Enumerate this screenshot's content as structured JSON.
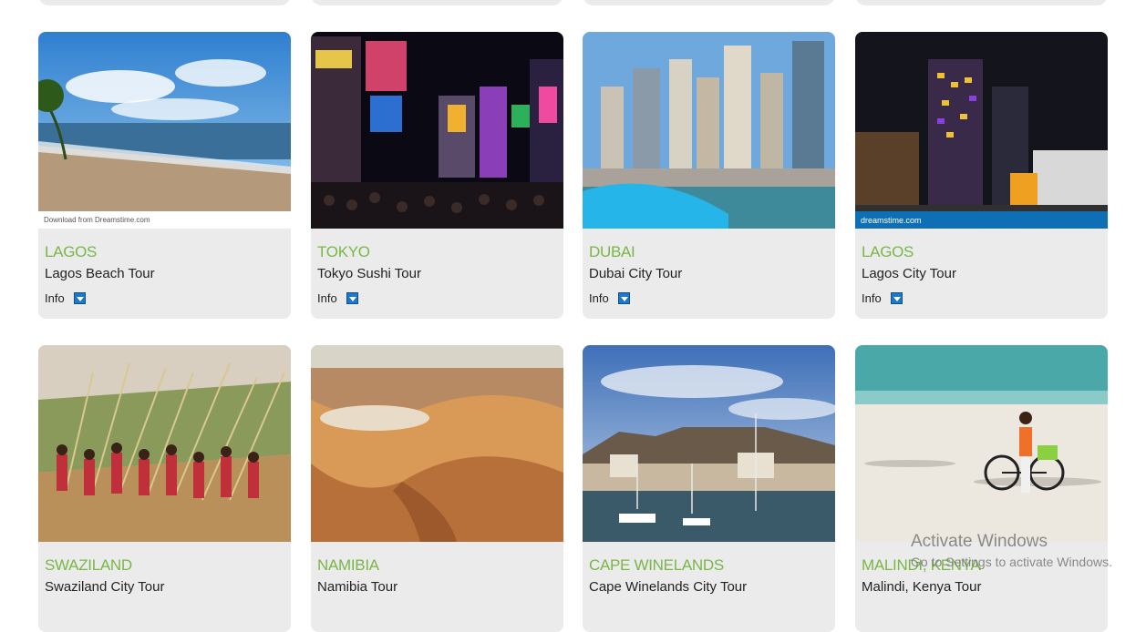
{
  "tours": [
    {
      "city": "LAGOS",
      "tour": "Lagos Beach Tour",
      "info": "Info",
      "watermark": "Download from Dreamstime.com"
    },
    {
      "city": "TOKYO",
      "tour": "Tokyo Sushi Tour",
      "info": "Info"
    },
    {
      "city": "DUBAI",
      "tour": "Dubai City Tour",
      "info": "Info"
    },
    {
      "city": "LAGOS",
      "tour": "Lagos City Tour",
      "info": "Info",
      "watermark": "dreamstime.com"
    },
    {
      "city": "SWAZILAND",
      "tour": "Swaziland City Tour"
    },
    {
      "city": "NAMIBIA",
      "tour": "Namibia Tour"
    },
    {
      "city": "CAPE WINELANDS",
      "tour": "Cape Winelands City Tour"
    },
    {
      "city": "MALINDI, KENYA",
      "tour": "Malindi, Kenya Tour"
    }
  ],
  "overlay": {
    "title": "Activate Windows",
    "subtitle": "Go to Settings to activate Windows."
  },
  "colors": {
    "accent_green": "#7ab648",
    "toggle_blue": "#1c78c9",
    "card_bg": "#ebebeb"
  }
}
